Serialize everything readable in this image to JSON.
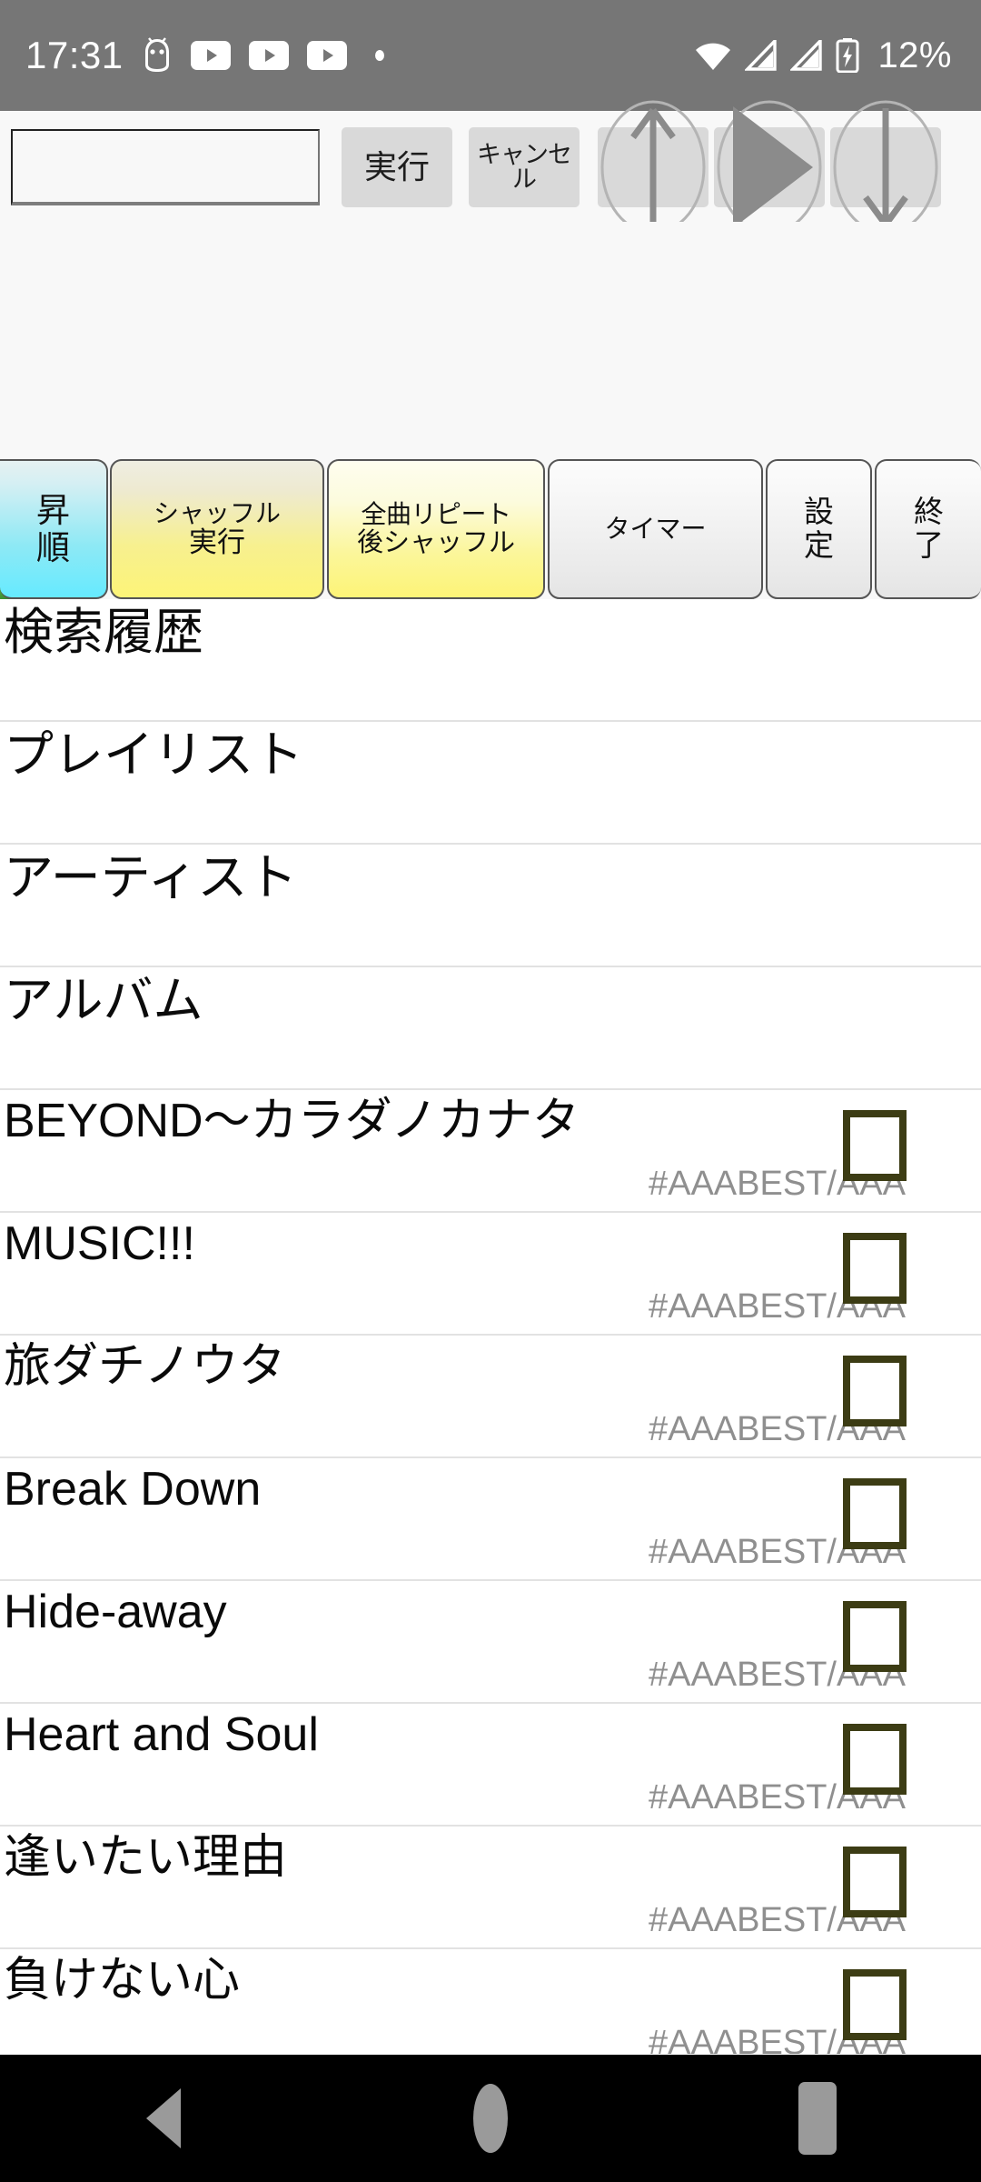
{
  "statusbar": {
    "time": "17:31",
    "battery_text": "12%",
    "icons": [
      "android-debug-icon",
      "youtube-icon",
      "youtube-icon",
      "youtube-icon",
      "dot-icon",
      "wifi-icon",
      "signal-icon",
      "signal-icon",
      "battery-charging-icon"
    ]
  },
  "toolbar": {
    "search_value": "",
    "search_placeholder": "",
    "execute_label": "実行",
    "cancel_label": "キャンセル",
    "up_icon": "arrow-up-icon",
    "play_icon": "play-icon",
    "down_icon": "arrow-down-icon"
  },
  "player": {
    "play_icon": "play-triangle-icon",
    "seek_value": 0,
    "seek_thumb_color": "#3c8478",
    "seek_track_color": "#dcdcdc"
  },
  "buttonbar": {
    "buttons": [
      {
        "line1": "昇",
        "line2": "順",
        "style": "cyan"
      },
      {
        "line1": "シャッフル",
        "line2": "実行",
        "style": "yellow"
      },
      {
        "line1": "全曲リピート",
        "line2": "後シャッフル",
        "style": "yellow2"
      },
      {
        "line1": "タイマー",
        "line2": "",
        "style": "gray"
      },
      {
        "line1": "設",
        "line2": "定",
        "style": "gray"
      },
      {
        "line1": "終",
        "line2": "了",
        "style": "gray"
      }
    ]
  },
  "list": {
    "nav_items": [
      {
        "label": "検索履歴"
      },
      {
        "label": "プレイリスト"
      },
      {
        "label": "アーティスト"
      },
      {
        "label": "アルバム"
      }
    ],
    "songs": [
      {
        "title": "BEYOND〜カラダノカナタ",
        "subtitle": "#AAABEST/AAA",
        "checked": false
      },
      {
        "title": "MUSIC!!!",
        "subtitle": "#AAABEST/AAA",
        "checked": false
      },
      {
        "title": "旅ダチノウタ",
        "subtitle": "#AAABEST/AAA",
        "checked": false
      },
      {
        "title": "Break Down",
        "subtitle": "#AAABEST/AAA",
        "checked": false
      },
      {
        "title": "Hide-away",
        "subtitle": "#AAABEST/AAA",
        "checked": false
      },
      {
        "title": "Heart and Soul",
        "subtitle": "#AAABEST/AAA",
        "checked": false
      },
      {
        "title": "逢いたい理由",
        "subtitle": "#AAABEST/AAA",
        "checked": false
      },
      {
        "title": "負けない心",
        "subtitle": "#AAABEST/AAA",
        "checked": false
      }
    ]
  },
  "navbar": {
    "back_icon": "back-triangle-icon",
    "home_icon": "home-circle-icon",
    "recents_icon": "recents-square-icon"
  },
  "colors": {
    "statusbar_bg": "#767676",
    "app_bg": "#f8f8f8",
    "checkbox_border": "#3c3c14",
    "accent_green": "#3c8478",
    "navbar_bg": "#000000"
  }
}
